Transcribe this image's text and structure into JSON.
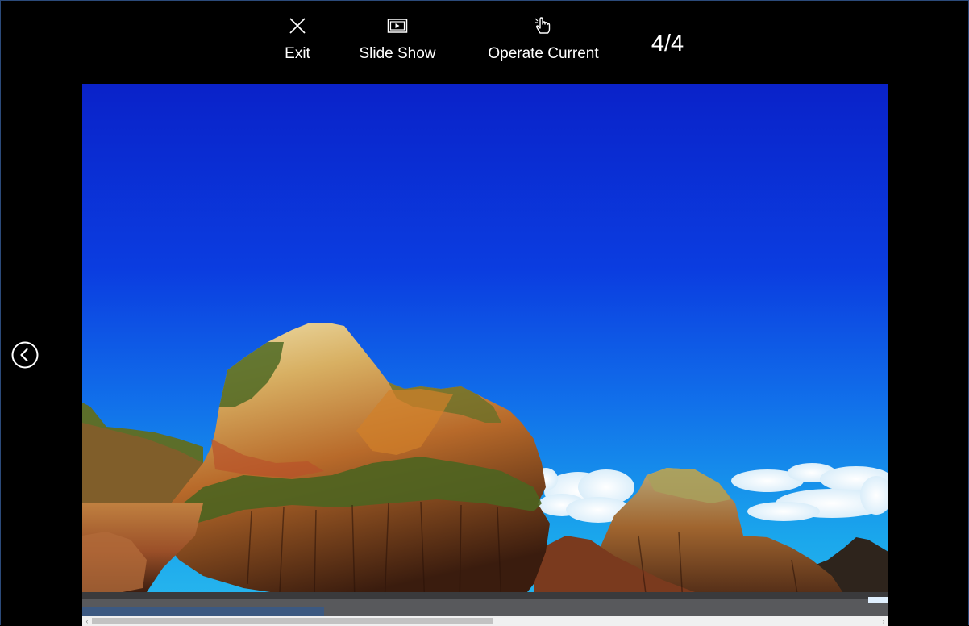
{
  "toolbar": {
    "exit_label": "Exit",
    "exit_icon": "close-icon",
    "slideshow_label": "Slide Show",
    "slideshow_icon": "slideshow-icon",
    "operate_label": "Operate Current",
    "operate_icon": "hand-pointer-icon"
  },
  "counter": "4/4",
  "navigation": {
    "prev_icon": "chevron-left-circle-icon"
  },
  "scrollbar": {
    "position_fraction": 0.0,
    "visible_fraction": 0.51
  },
  "colors": {
    "background": "#000000",
    "text": "#ffffff",
    "sky_top": "#0b2fd1",
    "sky_bottom": "#1a9ae8"
  }
}
